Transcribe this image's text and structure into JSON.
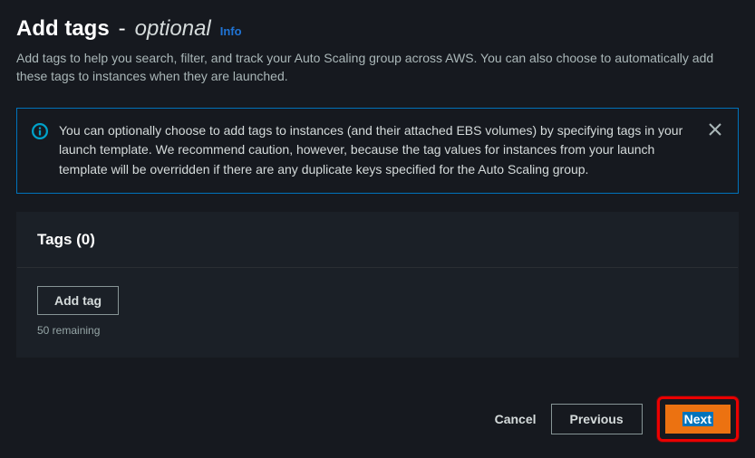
{
  "header": {
    "title": "Add tags",
    "separator": "-",
    "optional": "optional",
    "info": "Info"
  },
  "description": "Add tags to help you search, filter, and track your Auto Scaling group across AWS. You can also choose to automatically add these tags to instances when they are launched.",
  "alert": {
    "text": "You can optionally choose to add tags to instances (and their attached EBS volumes) by specifying tags in your launch template. We recommend caution, however, because the tag values for instances from your launch template will be overridden if there are any duplicate keys specified for the Auto Scaling group."
  },
  "tagsPanel": {
    "heading": "Tags (0)",
    "addButton": "Add tag",
    "remaining": "50 remaining"
  },
  "footer": {
    "cancel": "Cancel",
    "previous": "Previous",
    "next": "Next"
  }
}
